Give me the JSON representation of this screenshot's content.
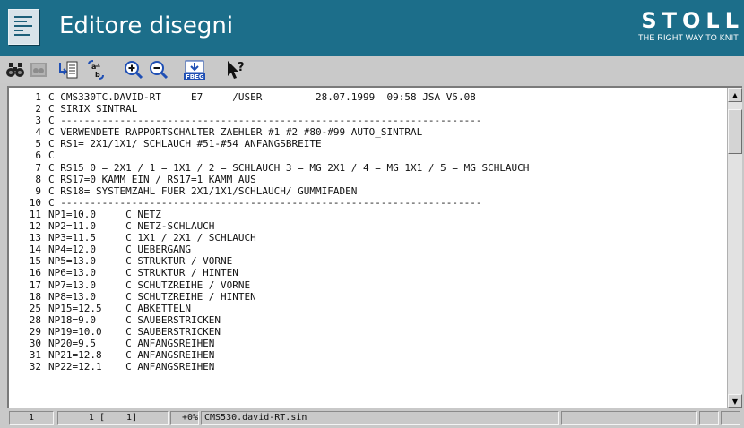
{
  "window": {
    "title": "Editore disegni",
    "brand_name": "STOLL",
    "brand_tagline": "THE RIGHT WAY TO KNIT"
  },
  "toolbar": {
    "buttons": [
      {
        "name": "find",
        "icon": "binoculars-icon",
        "enabled": true
      },
      {
        "name": "find-next",
        "icon": "binoculars-disabled-icon",
        "enabled": false
      },
      {
        "name": "goto-line",
        "icon": "goto-line-icon",
        "enabled": true
      },
      {
        "name": "replace",
        "icon": "replace-icon",
        "enabled": true
      },
      {
        "name": "zoom-in",
        "icon": "zoom-in-icon",
        "enabled": true
      },
      {
        "name": "zoom-out",
        "icon": "zoom-out-icon",
        "enabled": true
      },
      {
        "name": "fbeg",
        "icon": "fbeg-icon",
        "label": "FBEG",
        "enabled": true
      },
      {
        "name": "help",
        "icon": "context-help-icon",
        "enabled": true
      }
    ]
  },
  "editor": {
    "lines": [
      {
        "n": "1",
        "text": "C CMS330TC.DAVID-RT     E7     /USER         28.07.1999  09:58 JSA V5.08"
      },
      {
        "n": "2",
        "text": "C SIRIX SINTRAL"
      },
      {
        "n": "3",
        "text": "C -----------------------------------------------------------------------"
      },
      {
        "n": "4",
        "text": "C VERWENDETE RAPPORTSCHALTER ZAEHLER #1 #2 #80-#99 AUTO_SINTRAL"
      },
      {
        "n": "5",
        "text": "C RS1= 2X1/1X1/ SCHLAUCH #51-#54 ANFANGSBREITE"
      },
      {
        "n": "6",
        "text": "C"
      },
      {
        "n": "7",
        "text": "C RS15 0 = 2X1 / 1 = 1X1 / 2 = SCHLAUCH 3 = MG 2X1 / 4 = MG 1X1 / 5 = MG SCHLAUCH"
      },
      {
        "n": "8",
        "text": "C RS17=0 KAMM EIN / RS17=1 KAMM AUS"
      },
      {
        "n": "9",
        "text": "C RS18= SYSTEMZAHL FUER 2X1/1X1/SCHLAUCH/ GUMMIFADEN"
      },
      {
        "n": "10",
        "text": "C -----------------------------------------------------------------------"
      },
      {
        "n": "11",
        "text": "NP1=10.0     C NETZ"
      },
      {
        "n": "12",
        "text": "NP2=11.0     C NETZ-SCHLAUCH"
      },
      {
        "n": "13",
        "text": "NP3=11.5     C 1X1 / 2X1 / SCHLAUCH"
      },
      {
        "n": "14",
        "text": "NP4=12.0     C UEBERGANG"
      },
      {
        "n": "15",
        "text": "NP5=13.0     C STRUKTUR / VORNE"
      },
      {
        "n": "16",
        "text": "NP6=13.0     C STRUKTUR / HINTEN"
      },
      {
        "n": "17",
        "text": "NP7=13.0     C SCHUTZREIHE / VORNE"
      },
      {
        "n": "18",
        "text": "NP8=13.0     C SCHUTZREIHE / HINTEN"
      },
      {
        "n": "25",
        "text": "NP15=12.5    C ABKETTELN"
      },
      {
        "n": "28",
        "text": "NP18=9.0     C SAUBERSTRICKEN"
      },
      {
        "n": "29",
        "text": "NP19=10.0    C SAUBERSTRICKEN"
      },
      {
        "n": "30",
        "text": "NP20=9.5     C ANFANGSREIHEN"
      },
      {
        "n": "31",
        "text": "NP21=12.8    C ANFANGSREIHEN"
      },
      {
        "n": "32",
        "text": "NP22=12.1    C ANFANGSREIHEN"
      }
    ]
  },
  "statusbar": {
    "line": "1",
    "position": "1 [    1]",
    "percent": "+0%",
    "filename": "CMS530.david-RT.sin"
  },
  "colors": {
    "titlebar": "#1c6e8a",
    "chrome": "#c9c9c9",
    "editor_bg": "#ffffff"
  }
}
